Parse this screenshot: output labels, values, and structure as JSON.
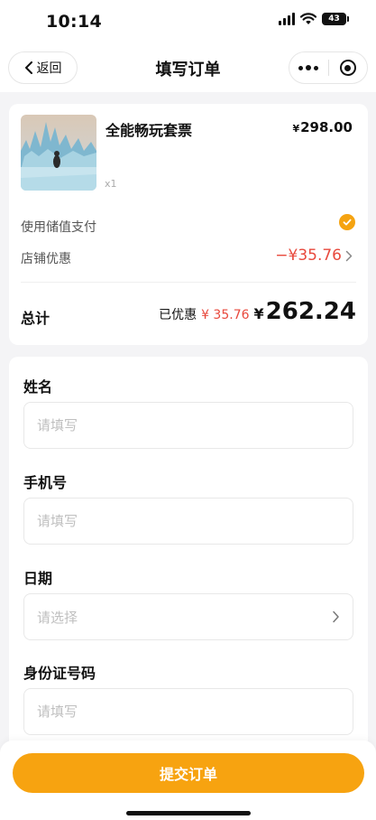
{
  "status_bar": {
    "time": "10:14",
    "battery": "43"
  },
  "nav": {
    "back_label": "返回",
    "title": "填写订单"
  },
  "order": {
    "product_name": "全能畅玩套票",
    "price_currency": "¥",
    "price": "298.00",
    "quantity": "x1",
    "stored_value_label": "使用储值支付",
    "stored_value_checked": true,
    "store_discount_label": "店铺优惠",
    "store_discount_value": "−¥35.76",
    "total_label": "总计",
    "saved_label": "已优惠",
    "saved_value": "¥ 35.76",
    "total_currency": "¥",
    "total_value": "262.24"
  },
  "form": {
    "name": {
      "label": "姓名",
      "placeholder": "请填写"
    },
    "phone": {
      "label": "手机号",
      "placeholder": "请填写"
    },
    "date": {
      "label": "日期",
      "placeholder": "请选择"
    },
    "id_number": {
      "label": "身份证号码",
      "placeholder": "请填写"
    }
  },
  "submit_label": "提交订单",
  "colors": {
    "accent": "#f7a310",
    "discount_red": "#e8493d",
    "background": "#f4f4f6"
  },
  "icons": [
    "chevron-left-icon",
    "more-dots-icon",
    "target-icon",
    "check-icon",
    "chevron-right-icon",
    "signal-icon",
    "wifi-icon",
    "battery-icon"
  ]
}
